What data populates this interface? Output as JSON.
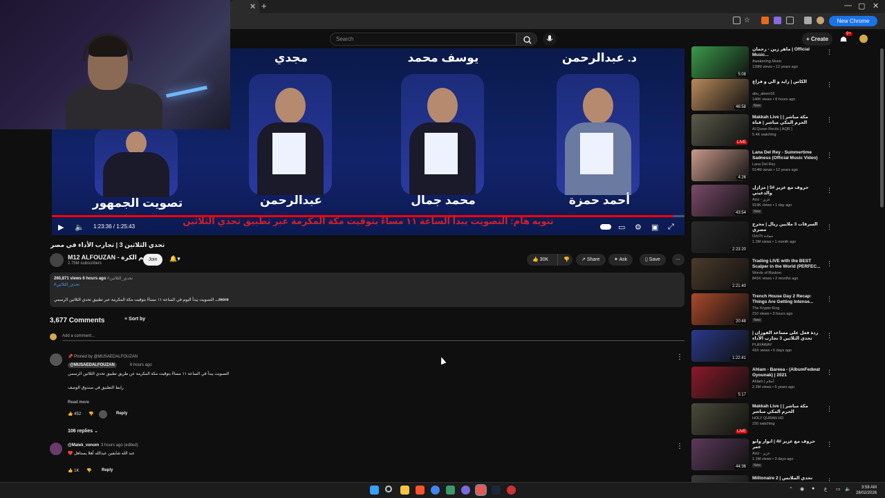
{
  "browser": {
    "new_chrome": "New Chrome available"
  },
  "header": {
    "search_placeholder": "Search",
    "create_label": "Create",
    "notif_count": "9+"
  },
  "video": {
    "names": [
      "مجدي",
      "يوسف محمد",
      "د. عبدالرحمن",
      "تصويت الجمهور",
      "عبدالرحمن",
      "محمد جمال",
      "أحمد حمزة"
    ],
    "ticker": "تنويه هام: التصويت يبدأ الساعة ١١ مساءً بتوقيت مكة المكرمة عبر تطبيق تحدي الثلاثين",
    "time": "1:23:36 / 1:25:43",
    "progress": 0.983
  },
  "info": {
    "title": "تحدي الثلاثين 3 | تجارب الأداء في مصر",
    "channel": "M12 ALFOUZAN - عم الكرة",
    "subscribers": "2.75M subscribers",
    "join": "Join",
    "likes": "30K",
    "share": "Share",
    "ask": "Ask",
    "save": "Save"
  },
  "description": {
    "meta": "260,871 views  6 hours ago",
    "tag_inline": "#تحدي_الثلاثين",
    "tags": [
      "#تحدي_الثلاثين"
    ],
    "text": "التصويت يبدأ اليوم في الساعة ١١ مساءً بتوقيت مكة المكرمة عبر تطبيق تحدي الثلاثين الرسمي",
    "more": "...more"
  },
  "comments": {
    "count": "3,677 Comments",
    "sort": "Sort by",
    "add": "Add a comment...",
    "list": [
      {
        "pinned": "Pinned by @MUSAEDALFOUZAN",
        "author": "@MUSAEDALFOUZAN",
        "time": "6 hours ago",
        "line1": "التصويت يبدأ في الساعة ١١ مساءً بتوقيت مكة المكرمة عن طريق تطبيق تحدي الثلاثين الرسمي",
        "line2": "رابط التطبيق في صندوق الوصف",
        "read_more": "Read more",
        "likes": "452",
        "reply": "Reply",
        "replies": "106 replies"
      },
      {
        "author": "@Malek_venom",
        "time": "3 hours ago (edited)",
        "line1": "عبد الله شايفين عبدالله أهلا يستاهل",
        "likes": "1K",
        "reply": "Reply"
      }
    ]
  },
  "sidebar": [
    {
      "title": "ماهر زين - رحمان | Official Music...",
      "channel": "Awakening Music",
      "views": "139M views • 12 years ago",
      "dur": "5:08",
      "color": "#3a9a4a"
    },
    {
      "title": "الكاس | زايد و الي و فزاع",
      "channel": "abu_abeer16",
      "views": "146K views • 8 hours ago",
      "dur": "46:58",
      "new": "New",
      "color": "#b88a5a"
    },
    {
      "title": "Makkah Live | مكة مباشر | الحرم المكي مباشر | قناة القرآن الكريم السعودية",
      "channel": "Al Quran Recits [ AQR ]",
      "views": "5.4K watching",
      "dur": "LIVE",
      "color": "#5a5a4a"
    },
    {
      "title": "Lana Del Rey - Summertime Sadness (Official Music Video)",
      "channel": "Lana Del Rey",
      "views": "914M views • 12 years ago",
      "dur": "4:26",
      "color": "#c99a8a"
    },
    {
      "title": "حروف مع عزيز #5 | مزازل والدغيثي",
      "channel": "Aziz - عزيز",
      "views": "919K views • 1 day ago",
      "dur": "43:54",
      "new": "New",
      "color": "#7a4a6a"
    },
    {
      "title": "السرقات 3 ملايين ريال | مخرج مصري",
      "channel": "Orb7h حمادة",
      "views": "1.2M views • 1 month ago",
      "dur": "2:23:20",
      "color": "#2a2a2a"
    },
    {
      "title": "Trading LIVE with the BEST Scalper in the World (PERFEC...",
      "channel": "Words of Rizdom",
      "views": "841K views • 2 months ago",
      "dur": "2:21:40",
      "color": "#4a3a2a"
    },
    {
      "title": "Trench House Day 2 Recap: Things Are Getting Intense...",
      "channel": "The Krypto King",
      "views": "210 views • 3 hours ago",
      "dur": "20:48",
      "new": "New",
      "color": "#aa4a2a"
    },
    {
      "title": "ردة فعل على مساعد الفوزان | تحدي الثلاثين 3 تجارب الأداء",
      "channel": "PLAYAWAY",
      "views": "41K views • 6 days ago",
      "dur": "1:22:41",
      "color": "#2a3a8a"
    },
    {
      "title": "Ahlam - Bareea - (AlbumFedwat Oyounak) | 2021",
      "channel": "Ahlam | أحلام",
      "views": "2.2M views • 5 years ago",
      "dur": "5:17",
      "color": "#8a1a2a"
    },
    {
      "title": "Makkah Live | مكة مباشر | الحرم المكي مباشر",
      "channel": "HOLY QURAN HD",
      "views": "230 watching",
      "dur": "LIVE",
      "color": "#4a4a3a"
    },
    {
      "title": "حروف مع عزيز #4 | أنوار وابو عمر",
      "channel": "Aziz - عزيز",
      "views": "1.1M views • 3 days ago",
      "dur": "44:36",
      "new": "New",
      "color": "#5a3a5a"
    },
    {
      "title": "Millionaire 2 | تحدي الملابس",
      "channel": "",
      "views": "",
      "dur": "",
      "color": "#3a3a3a"
    }
  ],
  "taskbar": {
    "time": "3:58 AM",
    "date": "28/02/2026"
  }
}
